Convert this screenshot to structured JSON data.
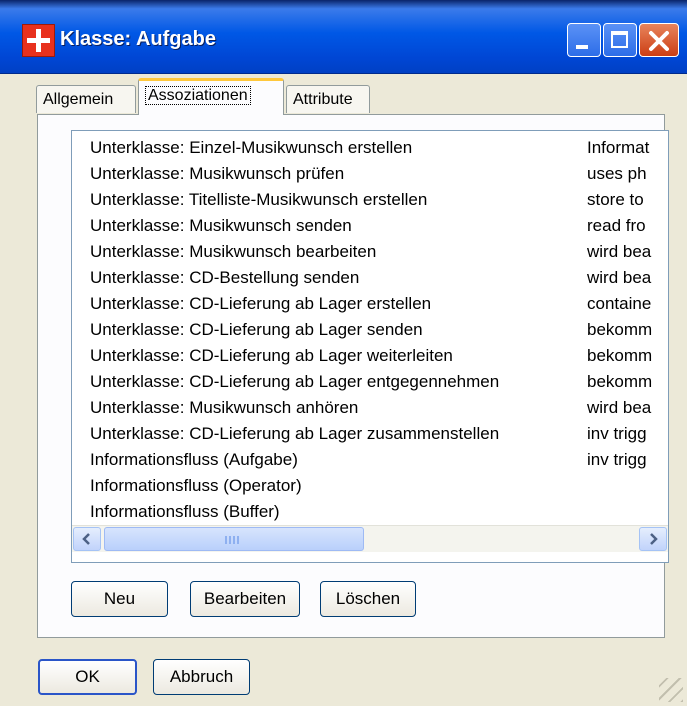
{
  "window": {
    "title": "Klasse: Aufgabe",
    "icon": "red-cross-app-icon"
  },
  "tabs": [
    {
      "label": "Allgemein",
      "selected": false
    },
    {
      "label": "Assoziationen",
      "selected": true
    },
    {
      "label": "Attribute",
      "selected": false
    }
  ],
  "list": {
    "rows": [
      {
        "name": "Unterklasse: Einzel-Musikwunsch erstellen",
        "detail": "Informat"
      },
      {
        "name": "Unterklasse: Musikwunsch prüfen",
        "detail": "uses ph"
      },
      {
        "name": "Unterklasse: Titelliste-Musikwunsch erstellen",
        "detail": "store to"
      },
      {
        "name": "Unterklasse: Musikwunsch senden",
        "detail": "read fro"
      },
      {
        "name": "Unterklasse: Musikwunsch bearbeiten",
        "detail": "wird bea"
      },
      {
        "name": "Unterklasse: CD-Bestellung senden",
        "detail": "wird bea"
      },
      {
        "name": "Unterklasse: CD-Lieferung ab Lager erstellen",
        "detail": "containe"
      },
      {
        "name": "Unterklasse: CD-Lieferung ab Lager senden",
        "detail": "bekomm"
      },
      {
        "name": "Unterklasse: CD-Lieferung ab Lager weiterleiten",
        "detail": "bekomm"
      },
      {
        "name": "Unterklasse: CD-Lieferung ab Lager entgegennehmen",
        "detail": "bekomm"
      },
      {
        "name": "Unterklasse: Musikwunsch anhören",
        "detail": "wird bea"
      },
      {
        "name": "Unterklasse: CD-Lieferung ab Lager zusammenstellen",
        "detail": "inv trigg"
      },
      {
        "name": "Informationsfluss (Aufgabe)",
        "detail": "inv trigg"
      },
      {
        "name": "Informationsfluss (Operator)",
        "detail": ""
      },
      {
        "name": "Informationsfluss (Buffer)",
        "detail": ""
      }
    ]
  },
  "list_buttons": {
    "new": "Neu",
    "edit": "Bearbeiten",
    "delete": "Löschen"
  },
  "dialog_buttons": {
    "ok": "OK",
    "cancel": "Abbruch"
  }
}
